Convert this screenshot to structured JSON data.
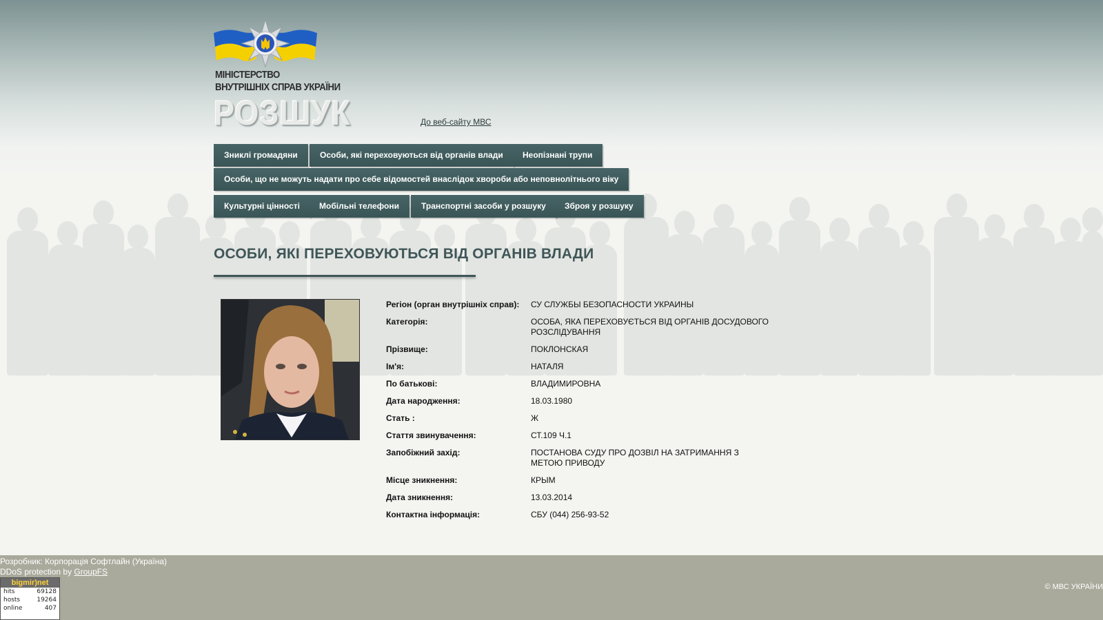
{
  "header": {
    "ministry_line1": "МІНІСТЕРСТВО",
    "ministry_line2": "ВНУТРІШНІХ СПРАВ УКРАЇНИ",
    "section_title": "РОЗШУК",
    "mvs_link": "До веб-сайту МВС"
  },
  "nav": {
    "row1": [
      "Зниклі громадяни",
      "Особи, які переховуються від органів влади",
      "Неопізнані трупи"
    ],
    "row2": [
      "Особи, що не можуть надати про себе відомостей внаслідок хвороби або неповнолітнього віку"
    ],
    "row3": [
      "Культурні цінності",
      "Мобільні телефони",
      "Транспортні засоби у розшуку",
      "Зброя у розшуку"
    ]
  },
  "page": {
    "title": "ОСОБИ, ЯКІ ПЕРЕХОВУЮТЬСЯ ВІД ОРГАНІВ ВЛАДИ"
  },
  "record": [
    {
      "label": "Регіон (орган внутрішніх справ):",
      "value": "СУ СЛУЖБЫ БЕЗОПАСНОСТИ УКРАИНЫ"
    },
    {
      "label": "Категорія:",
      "value": "ОСОБА, ЯКА ПЕРЕХОВУЄТЬСЯ ВІД ОРГАНІВ ДОСУДОВОГО РОЗСЛІДУВАННЯ"
    },
    {
      "label": "Прізвище:",
      "value": "ПОКЛОНСКАЯ"
    },
    {
      "label": "Ім'я:",
      "value": "НАТАЛЯ"
    },
    {
      "label": "По батькові:",
      "value": "ВЛАДИМИРОВНА"
    },
    {
      "label": "Дата народження:",
      "value": "18.03.1980"
    },
    {
      "label": "Стать :",
      "value": "Ж"
    },
    {
      "label": "Стаття звинувачення:",
      "value": "СТ.109 Ч.1"
    },
    {
      "label": "Запобіжний захід:",
      "value": "ПОСТАНОВА СУДУ ПРО ДОЗВІЛ НА ЗАТРИМАННЯ З МЕТОЮ ПРИВОДУ"
    },
    {
      "label": "Місце зникнення:",
      "value": "КРЫМ"
    },
    {
      "label": "Дата зникнення:",
      "value": "13.03.2014"
    },
    {
      "label": "Контактна інформація:",
      "value": "СБУ (044) 256-93-52"
    }
  ],
  "footer": {
    "developer": "Розробник: Корпорація Софтлайн (Україна)",
    "ddos_prefix": "DDoS protection",
    "ddos_by": "by",
    "ddos_link": "GroupFS",
    "counter_brand": "bigmir)net",
    "counter": [
      {
        "label": "hits",
        "value": "69128"
      },
      {
        "label": "hosts",
        "value": "19264"
      },
      {
        "label": "online",
        "value": "407"
      }
    ],
    "copyright": "© МВС УКРАЇНИ"
  },
  "colors": {
    "nav_bg": "#476466",
    "title": "#3f5657",
    "footer_bg": "#a9a99c",
    "flag_blue": "#1f5fc4",
    "flag_yellow": "#f5d000"
  },
  "icons": [
    "ministry-emblem-logo",
    "person-photo"
  ]
}
